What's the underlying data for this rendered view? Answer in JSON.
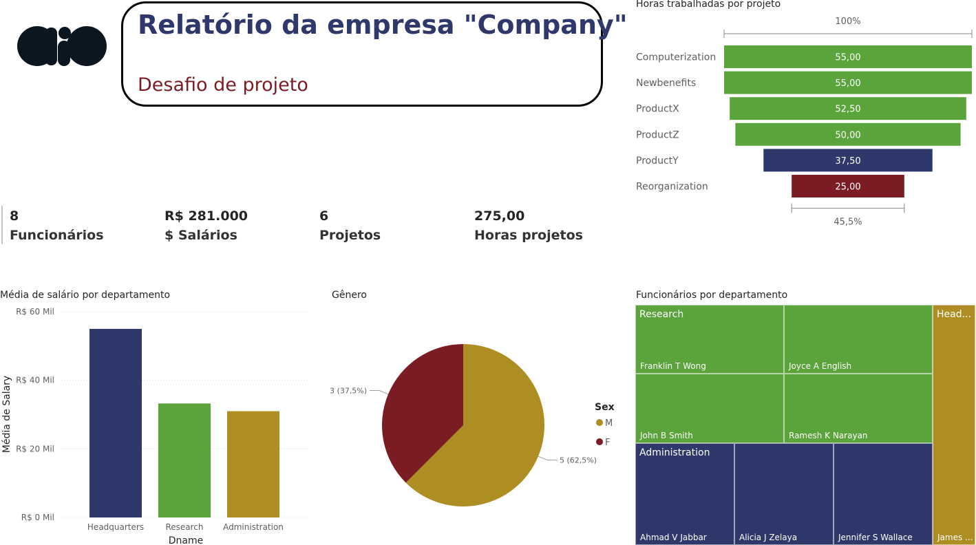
{
  "colors": {
    "navy": "#2E386B",
    "green": "#5BA33B",
    "gold": "#AE8E22",
    "maroon": "#7B1C25"
  },
  "header": {
    "logo_icon": "dio-logo",
    "title": "Relatório da empresa \"Company\"",
    "subtitle": "Desafio de projeto"
  },
  "kpis": [
    {
      "value": "8",
      "label": "Funcionários"
    },
    {
      "value": "R$ 281.000",
      "label": "$ Salários"
    },
    {
      "value": "6",
      "label": "Projetos"
    },
    {
      "value": "275,00",
      "label": "Horas projetos"
    }
  ],
  "chart_data": [
    {
      "type": "bar",
      "title": "Horas trabalhadas por projeto",
      "orientation": "funnel",
      "categories": [
        "Computerization",
        "Newbenefits",
        "ProductX",
        "ProductZ",
        "ProductY",
        "Reorganization"
      ],
      "values": [
        55,
        55,
        52.5,
        50,
        37.5,
        25
      ],
      "value_labels": [
        "55,00",
        "55,00",
        "52,50",
        "50,00",
        "37,50",
        "25,00"
      ],
      "bar_colors": [
        "#5BA33B",
        "#5BA33B",
        "#5BA33B",
        "#5BA33B",
        "#2E386B",
        "#7B1C25"
      ],
      "top_label": "100%",
      "bottom_label": "45,5%"
    },
    {
      "type": "bar",
      "title": "Média de salário por departamento",
      "categories": [
        "Headquarters",
        "Research",
        "Administration"
      ],
      "values": [
        55000,
        33250,
        31000
      ],
      "bar_colors": [
        "#2E386B",
        "#5BA33B",
        "#AE8E22"
      ],
      "xlabel": "Dname",
      "ylabel": "Média de Salary",
      "ylim": [
        0,
        60000
      ],
      "yticks": [
        0,
        20000,
        40000,
        60000
      ],
      "ytick_labels": [
        "R$ 0 Mil",
        "R$ 20 Mil",
        "R$ 40 Mil",
        "R$ 60 Mil"
      ],
      "grid": true
    },
    {
      "type": "pie",
      "title": "Gênero",
      "legend_title": "Sex",
      "legend_position": "right",
      "slices": [
        {
          "name": "M",
          "value": 5,
          "label": "5 (62,5%)",
          "color": "#AE8E22"
        },
        {
          "name": "F",
          "value": 3,
          "label": "3 (37,5%)",
          "color": "#7B1C25"
        }
      ]
    },
    {
      "type": "treemap",
      "title": "Funcionários por departamento",
      "groups": [
        {
          "name": "Research",
          "color": "#5BA33B",
          "items": [
            "Franklin T Wong",
            "Joyce A English",
            "John B Smith",
            "Ramesh K Narayan"
          ]
        },
        {
          "name": "Administration",
          "color": "#2E386B",
          "items": [
            "Ahmad V Jabbar",
            "Alicia J Zelaya",
            "Jennifer S Wallace"
          ]
        },
        {
          "name": "Head...",
          "color": "#AE8E22",
          "items": [
            "James ..."
          ]
        }
      ]
    }
  ]
}
